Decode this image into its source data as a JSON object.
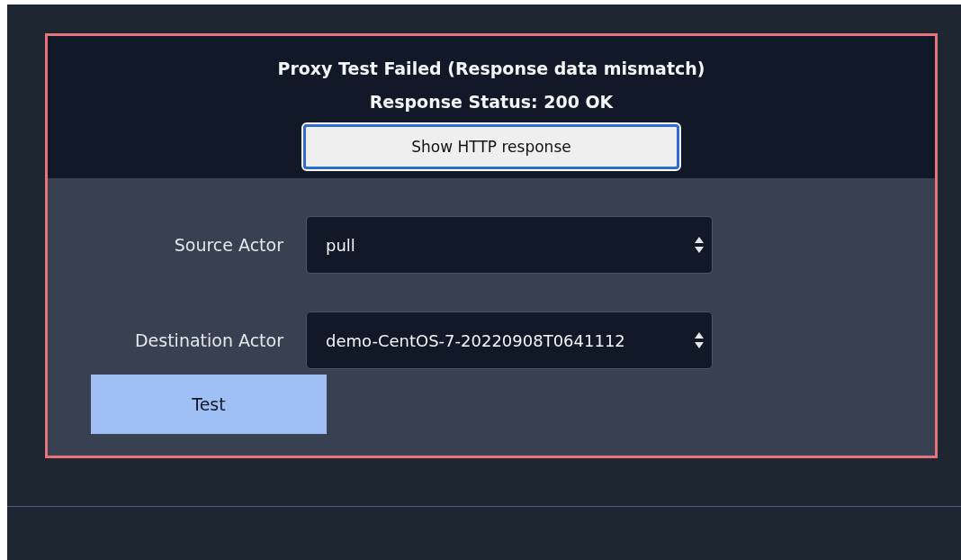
{
  "result": {
    "title": "Proxy Test Failed (Response data mismatch)",
    "status": "Response Status: 200 OK",
    "button": "Show HTTP response"
  },
  "fields": [
    {
      "label": "Source Actor",
      "value": "pull"
    },
    {
      "label": "Destination Actor",
      "value": "demo-CentOS-7-20220908T0641112"
    }
  ],
  "test_button": "Test"
}
